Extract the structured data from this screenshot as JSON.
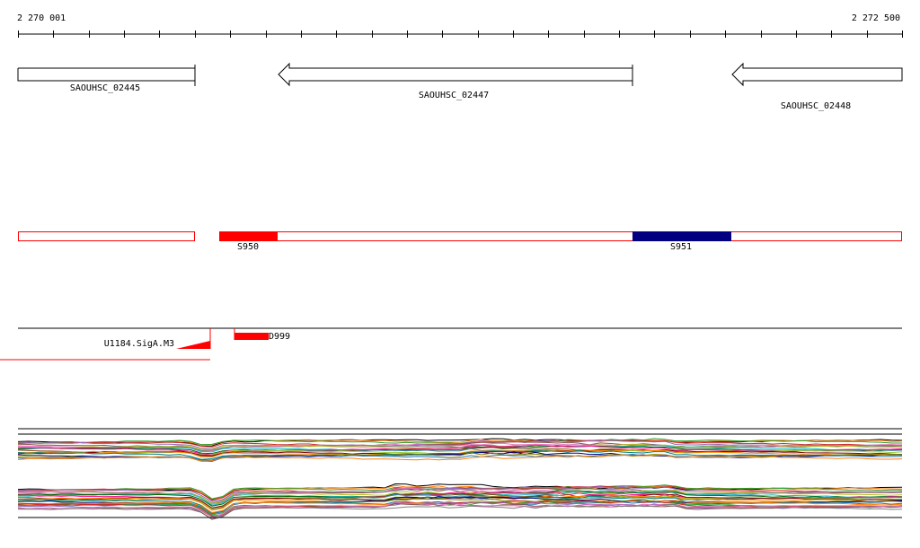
{
  "coords": {
    "start_label": "2 270 001",
    "end_label": "2 272 500"
  },
  "genes": [
    {
      "name": "SAOUHSC_02445",
      "strand": "+"
    },
    {
      "name": "SAOUHSC_02447",
      "strand": "-"
    },
    {
      "name": "SAOUHSC_02448",
      "strand": "-"
    }
  ],
  "segments": [
    {
      "name": "S950",
      "color": "#ff0000"
    },
    {
      "name": "S951",
      "color": "#000080"
    }
  ],
  "features": {
    "motif_label": "U1184.SigA.M3",
    "item_label": "D999",
    "color": "#ff0000"
  },
  "colors": {
    "segment_outline": "#ff0000",
    "gene_outline": "#000000"
  }
}
